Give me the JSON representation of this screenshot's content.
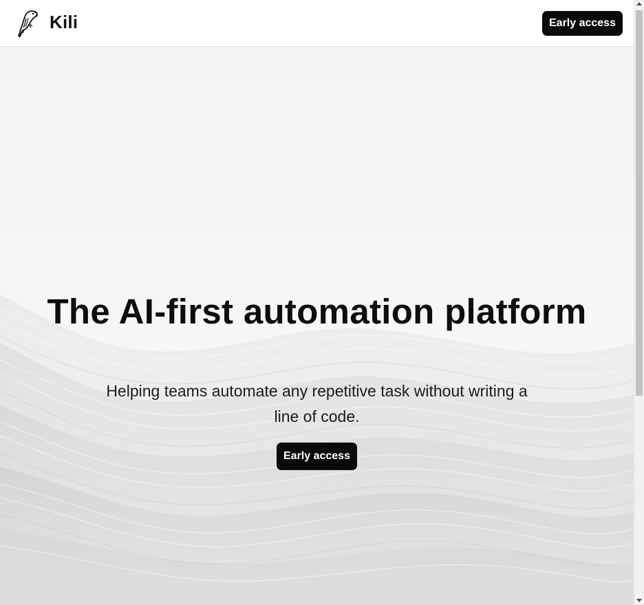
{
  "header": {
    "brand": "Kili",
    "logo_icon": "parrot-icon",
    "cta_label": "Early access"
  },
  "hero": {
    "title": "The AI-first automation platform",
    "subtitle": "Helping teams automate any repetitive task without writing a line of code.",
    "cta_label": "Early access",
    "background": "grey-waves"
  },
  "colors": {
    "button_bg": "#0a0a0a",
    "button_text": "#ffffff",
    "text": "#0d0d0d",
    "header_bg": "#ffffff"
  }
}
